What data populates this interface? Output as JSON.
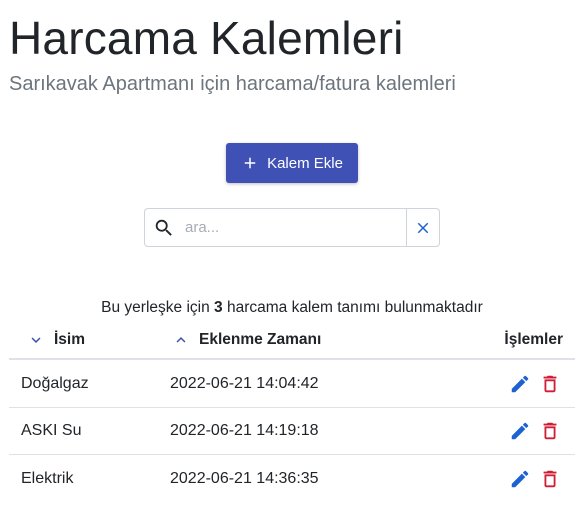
{
  "header": {
    "title": "Harcama Kalemleri",
    "subtitle": "Sarıkavak Apartmanı için harcama/fatura kalemleri"
  },
  "toolbar": {
    "add_label": "Kalem Ekle",
    "add_icon": "plus-icon"
  },
  "search": {
    "placeholder": "ara...",
    "value": "",
    "search_icon": "search-icon",
    "clear_icon": "close-icon"
  },
  "summary": {
    "prefix": "Bu yerleşke için",
    "count": "3",
    "suffix": "harcama kalem tanımı bulunmaktadır"
  },
  "table": {
    "columns": [
      {
        "label": "İsim",
        "sort_icon": "chevron-down-icon"
      },
      {
        "label": "Eklenme Zamanı",
        "sort_icon": "chevron-up-icon"
      },
      {
        "label": "İşlemler"
      }
    ],
    "rows": [
      {
        "name": "Doğalgaz",
        "added": "2022-06-21 14:04:42"
      },
      {
        "name": "ASKI Su",
        "added": "2022-06-21 14:19:18"
      },
      {
        "name": "Elektrik",
        "added": "2022-06-21 14:36:35"
      }
    ],
    "row_action_icons": [
      "pencil-icon",
      "trash-icon"
    ]
  },
  "colors": {
    "primary": "#3f51b5",
    "icon_blue": "#1e62d0",
    "sort_icon": "#3f51b5",
    "delete_red": "#d01e35",
    "subtitle_gray": "#6c757d"
  }
}
